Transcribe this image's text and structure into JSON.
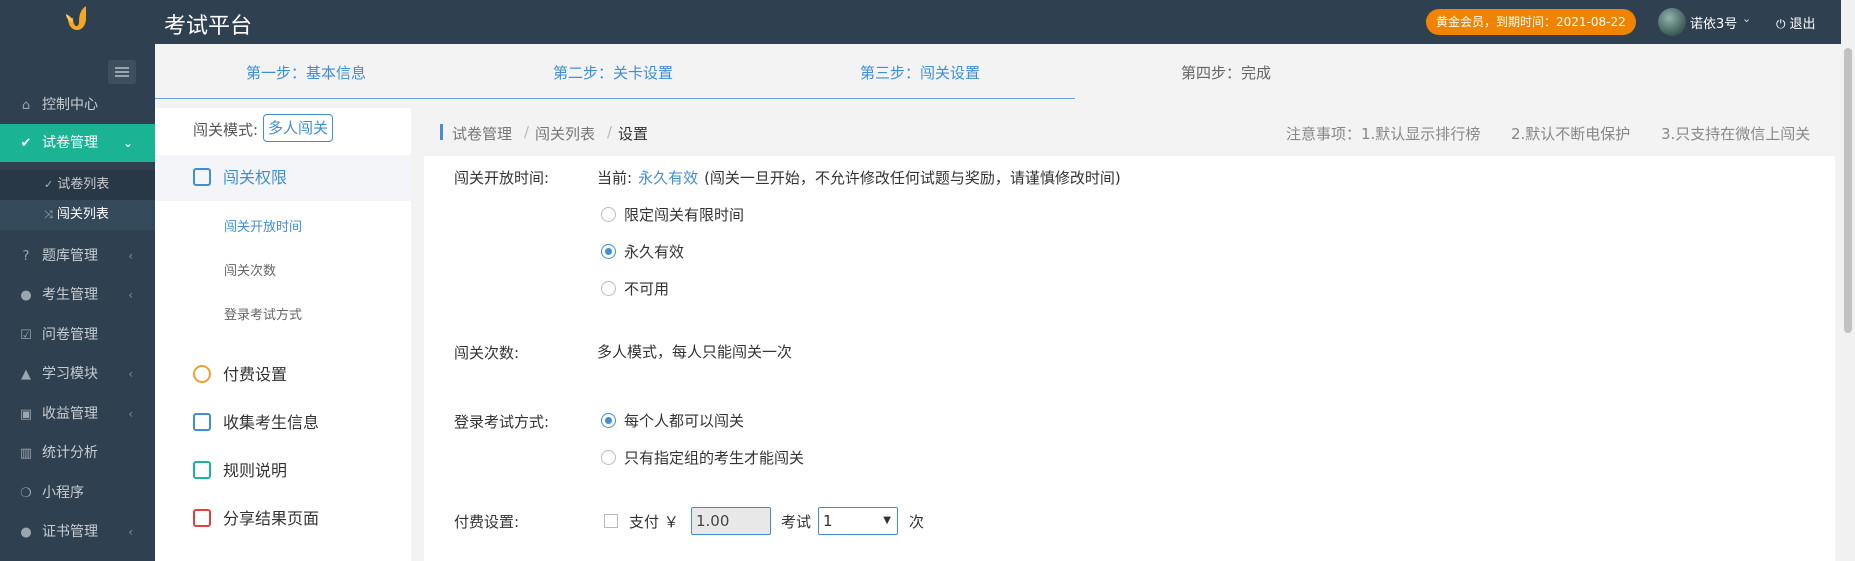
{
  "header": {
    "title": "考试平台",
    "vip": "黄金会员，到期时间：2021-08-22",
    "username": "诺依3号",
    "logout": "退出"
  },
  "nav": {
    "items": [
      {
        "label": "控制中心",
        "icon": "home-icon"
      },
      {
        "label": "试卷管理",
        "icon": "check-circle-icon",
        "active": true
      },
      {
        "label": "题库管理",
        "icon": "question-icon"
      },
      {
        "label": "考生管理",
        "icon": "user-icon"
      },
      {
        "label": "问卷管理",
        "icon": "checkbox-icon"
      },
      {
        "label": "学习模块",
        "icon": "graduation-cap-icon"
      },
      {
        "label": "收益管理",
        "icon": "money-icon"
      },
      {
        "label": "统计分析",
        "icon": "bar-chart-icon"
      },
      {
        "label": "小程序",
        "icon": "wechat-icon"
      },
      {
        "label": "证书管理",
        "icon": "certificate-icon"
      }
    ],
    "sub_items": [
      {
        "label": "试卷列表"
      },
      {
        "label": "闯关列表"
      }
    ]
  },
  "steps": [
    {
      "label": "第一步：基本信息"
    },
    {
      "label": "第二步：关卡设置"
    },
    {
      "label": "第三步：闯关设置"
    },
    {
      "label": "第四步：完成"
    }
  ],
  "side": {
    "mode_label": "闯关模式:",
    "mode_value": "多人闯关",
    "groups": [
      {
        "label": "闯关权限"
      },
      {
        "label": "付费设置"
      },
      {
        "label": "收集考生信息"
      },
      {
        "label": "规则说明"
      },
      {
        "label": "分享结果页面"
      }
    ],
    "subs": [
      {
        "label": "闯关开放时间"
      },
      {
        "label": "闯关次数"
      },
      {
        "label": "登录考试方式"
      }
    ]
  },
  "breadcrumb": {
    "items": [
      "试卷管理",
      "闯关列表",
      "设置"
    ],
    "sep": "/"
  },
  "notes": {
    "prefix": "注意事项：1.默认显示排行榜",
    "n2": "2.默认不断电保护",
    "n3": "3.只支持在微信上闯关"
  },
  "form": {
    "open_time": {
      "label": "闯关开放时间:",
      "current_prefix": "当前:",
      "current_value": "永久有效",
      "current_hint": "(闯关一旦开始，不允许修改任何试题与奖励，请谨慎修改时间)",
      "options": [
        "限定闯关有限时间",
        "永久有效",
        "不可用"
      ],
      "selected": 1
    },
    "times": {
      "label": "闯关次数:",
      "value": "多人模式，每人只能闯关一次"
    },
    "login": {
      "label": "登录考试方式:",
      "options": [
        "每个人都可以闯关",
        "只有指定组的考生才能闯关"
      ],
      "selected": 0
    },
    "pay": {
      "label": "付费设置:",
      "pay_text": "支付 ￥",
      "amount": "1.00",
      "exam_text": "考试",
      "count": "1",
      "unit": "次"
    }
  },
  "colors": {
    "nav_bg": "#2f4050",
    "active": "#1ab394",
    "accent": "#3f8ed6",
    "vip": "#f08400"
  }
}
